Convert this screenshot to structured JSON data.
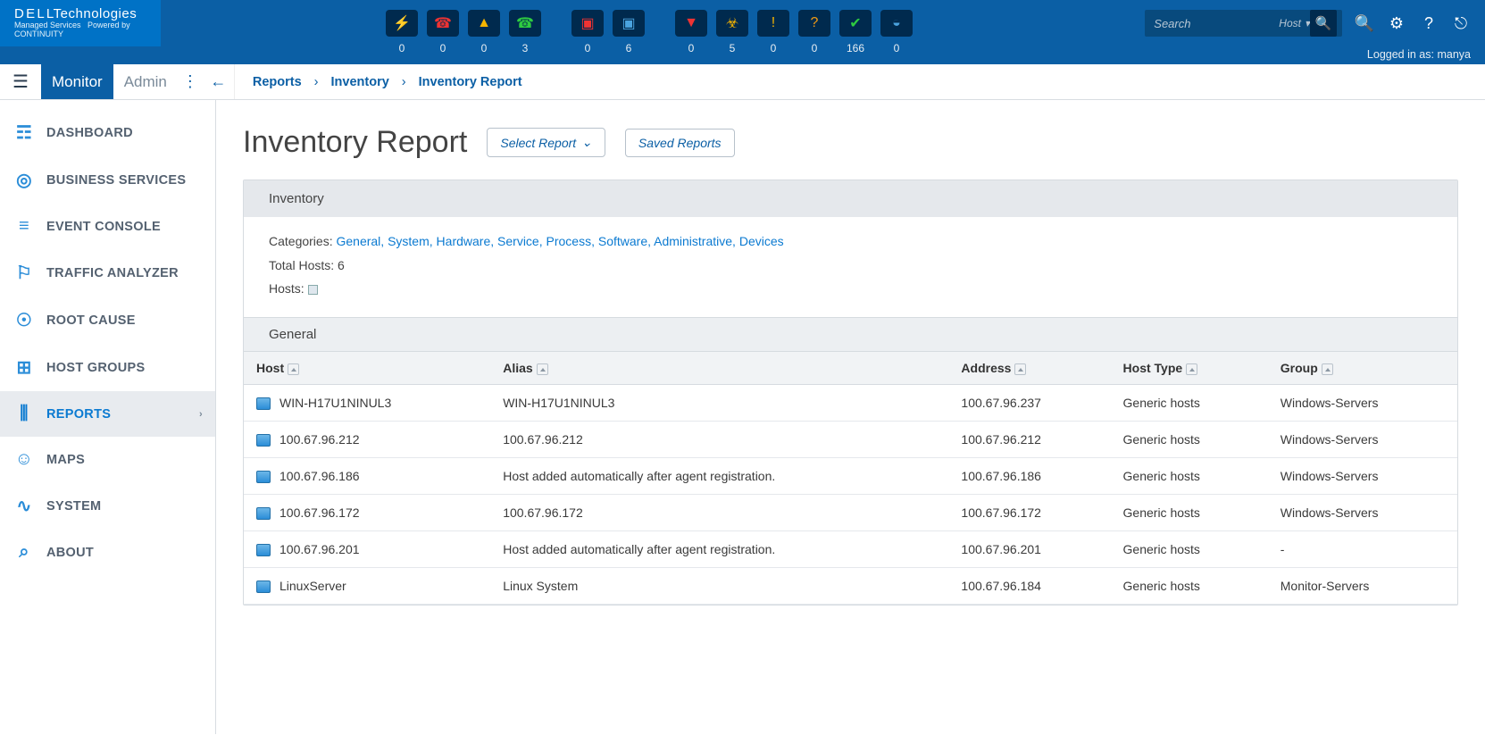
{
  "header": {
    "brand_line1": "D E L LTechnologies",
    "brand_line2": "Managed Services   Powered by CONTINUITY",
    "logged_in_label": "Logged in as:",
    "logged_in_user": "manya",
    "search_placeholder": "Search",
    "search_filter_label": "Host",
    "status_groups": [
      {
        "items": [
          {
            "name": "lightning-icon",
            "glyph": "⚡",
            "color": "#e33",
            "count": "0"
          },
          {
            "name": "phone-down-icon",
            "glyph": "☎",
            "color": "#e33",
            "count": "0"
          },
          {
            "name": "warning-icon",
            "glyph": "▲",
            "color": "#f5b400",
            "count": "0"
          },
          {
            "name": "phone-up-icon",
            "glyph": "☎",
            "color": "#2ecc40",
            "count": "3"
          }
        ]
      },
      {
        "items": [
          {
            "name": "host-down-icon",
            "glyph": "▣",
            "color": "#e33",
            "count": "0"
          },
          {
            "name": "host-up-icon",
            "glyph": "▣",
            "color": "#4aa3df",
            "count": "6"
          }
        ]
      },
      {
        "items": [
          {
            "name": "service-critical-icon",
            "glyph": "▼",
            "color": "#e33",
            "count": "0"
          },
          {
            "name": "service-warn-icon",
            "glyph": "☣",
            "color": "#f5b400",
            "count": "5"
          },
          {
            "name": "alert-icon",
            "glyph": "!",
            "color": "#f5b400",
            "count": "0"
          },
          {
            "name": "unknown-icon",
            "glyph": "?",
            "color": "#f39c12",
            "count": "0"
          },
          {
            "name": "ok-icon",
            "glyph": "✔",
            "color": "#2ecc40",
            "count": "166"
          },
          {
            "name": "pending-icon",
            "glyph": "◒",
            "color": "#4aa3df",
            "count": "0"
          }
        ]
      }
    ]
  },
  "modes": {
    "monitor": "Monitor",
    "admin": "Admin"
  },
  "breadcrumb": {
    "a": "Reports",
    "b": "Inventory",
    "c": "Inventory Report"
  },
  "sidebar": [
    {
      "icon": "☶",
      "label": "DASHBOARD",
      "name": "dashboard"
    },
    {
      "icon": "◎",
      "label": "BUSINESS SERVICES",
      "name": "business-services"
    },
    {
      "icon": "≡",
      "label": "EVENT CONSOLE",
      "name": "event-console"
    },
    {
      "icon": "⚐",
      "label": "TRAFFIC ANALYZER",
      "name": "traffic-analyzer"
    },
    {
      "icon": "☉",
      "label": "ROOT CAUSE",
      "name": "root-cause"
    },
    {
      "icon": "⊞",
      "label": "HOST GROUPS",
      "name": "host-groups"
    },
    {
      "icon": "⫼",
      "label": "REPORTS",
      "name": "reports",
      "active": true,
      "chevron": true
    },
    {
      "icon": "☺",
      "label": "MAPS",
      "name": "maps"
    },
    {
      "icon": "∿",
      "label": "SYSTEM",
      "name": "system"
    },
    {
      "icon": "⌕",
      "label": "ABOUT",
      "name": "about"
    }
  ],
  "page": {
    "title": "Inventory Report",
    "btn_select": "Select Report",
    "btn_saved": "Saved Reports",
    "panel_title": "Inventory",
    "categories_label": "Categories:",
    "categories": [
      "General",
      "System",
      "Hardware",
      "Service",
      "Process",
      "Software",
      "Administrative",
      "Devices"
    ],
    "total_hosts_label": "Total Hosts:",
    "total_hosts_value": "6",
    "hosts_label": "Hosts:",
    "section_title": "General",
    "columns": [
      "Host",
      "Alias",
      "Address",
      "Host Type",
      "Group"
    ],
    "rows": [
      {
        "host": "WIN-H17U1NINUL3",
        "alias": "WIN-H17U1NINUL3",
        "address": "100.67.96.237",
        "type": "Generic hosts",
        "group": "Windows-Servers"
      },
      {
        "host": "100.67.96.212",
        "alias": "100.67.96.212",
        "address": "100.67.96.212",
        "type": "Generic hosts",
        "group": "Windows-Servers"
      },
      {
        "host": "100.67.96.186",
        "alias": "Host added automatically after agent registration.",
        "address": "100.67.96.186",
        "type": "Generic hosts",
        "group": "Windows-Servers"
      },
      {
        "host": "100.67.96.172",
        "alias": "100.67.96.172",
        "address": "100.67.96.172",
        "type": "Generic hosts",
        "group": "Windows-Servers"
      },
      {
        "host": "100.67.96.201",
        "alias": "Host added automatically after agent registration.",
        "address": "100.67.96.201",
        "type": "Generic hosts",
        "group": "-"
      },
      {
        "host": "LinuxServer",
        "alias": "Linux System",
        "address": "100.67.96.184",
        "type": "Generic hosts",
        "group": "Monitor-Servers"
      }
    ]
  }
}
